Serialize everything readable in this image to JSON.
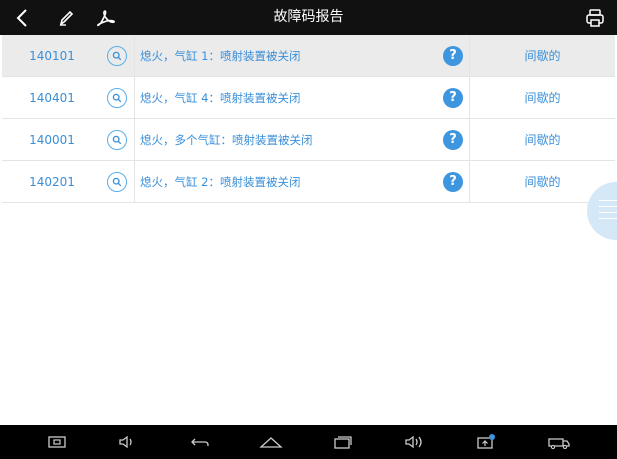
{
  "header": {
    "title": "故障码报告"
  },
  "rows": [
    {
      "code": "140101",
      "description": "熄火，气缸 1：喷射装置被关闭",
      "help": "?",
      "status": "间歇的",
      "selected": true
    },
    {
      "code": "140401",
      "description": "熄火，气缸 4：喷射装置被关闭",
      "help": "?",
      "status": "间歇的",
      "selected": false
    },
    {
      "code": "140001",
      "description": "熄火，多个气缸：喷射装置被关闭",
      "help": "?",
      "status": "间歇的",
      "selected": false
    },
    {
      "code": "140201",
      "description": "熄火，气缸 2：喷射装置被关闭",
      "help": "?",
      "status": "间歇的",
      "selected": false
    }
  ],
  "icons": {
    "back": "back-arrow-icon",
    "edit": "pen-icon",
    "pdf": "pdf-icon",
    "print": "printer-icon",
    "search": "search-icon",
    "help": "help-circle-icon",
    "float": "floating-menu-icon",
    "nav": [
      "screenshot-icon",
      "volume-down-icon",
      "nav-back-icon",
      "home-icon",
      "recent-apps-icon",
      "volume-up-icon",
      "app-badge-icon",
      "vehicle-icon"
    ]
  },
  "colors": {
    "accent": "#3a8fd8",
    "selected_row": "#ebebeb",
    "help_badge": "#3d96de"
  }
}
